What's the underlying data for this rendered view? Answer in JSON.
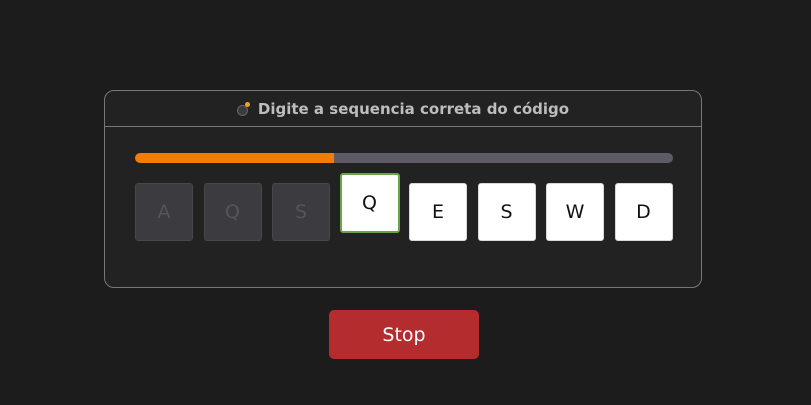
{
  "panel": {
    "title": "Digite a sequencia correta do código",
    "title_icon": "bomb-icon"
  },
  "progress": {
    "fraction": 0.37
  },
  "keys": [
    {
      "label": "A",
      "state": "done"
    },
    {
      "label": "Q",
      "state": "done"
    },
    {
      "label": "S",
      "state": "done"
    },
    {
      "label": "Q",
      "state": "current"
    },
    {
      "label": "E",
      "state": "pending"
    },
    {
      "label": "S",
      "state": "pending"
    },
    {
      "label": "W",
      "state": "pending"
    },
    {
      "label": "D",
      "state": "pending"
    }
  ],
  "stop_label": "Stop",
  "colors": {
    "background": "#1c1c1c",
    "progress_fill": "#f57c00",
    "progress_track": "#5e5b66",
    "current_border": "#6aa34a",
    "stop_button": "#b52c2f"
  }
}
